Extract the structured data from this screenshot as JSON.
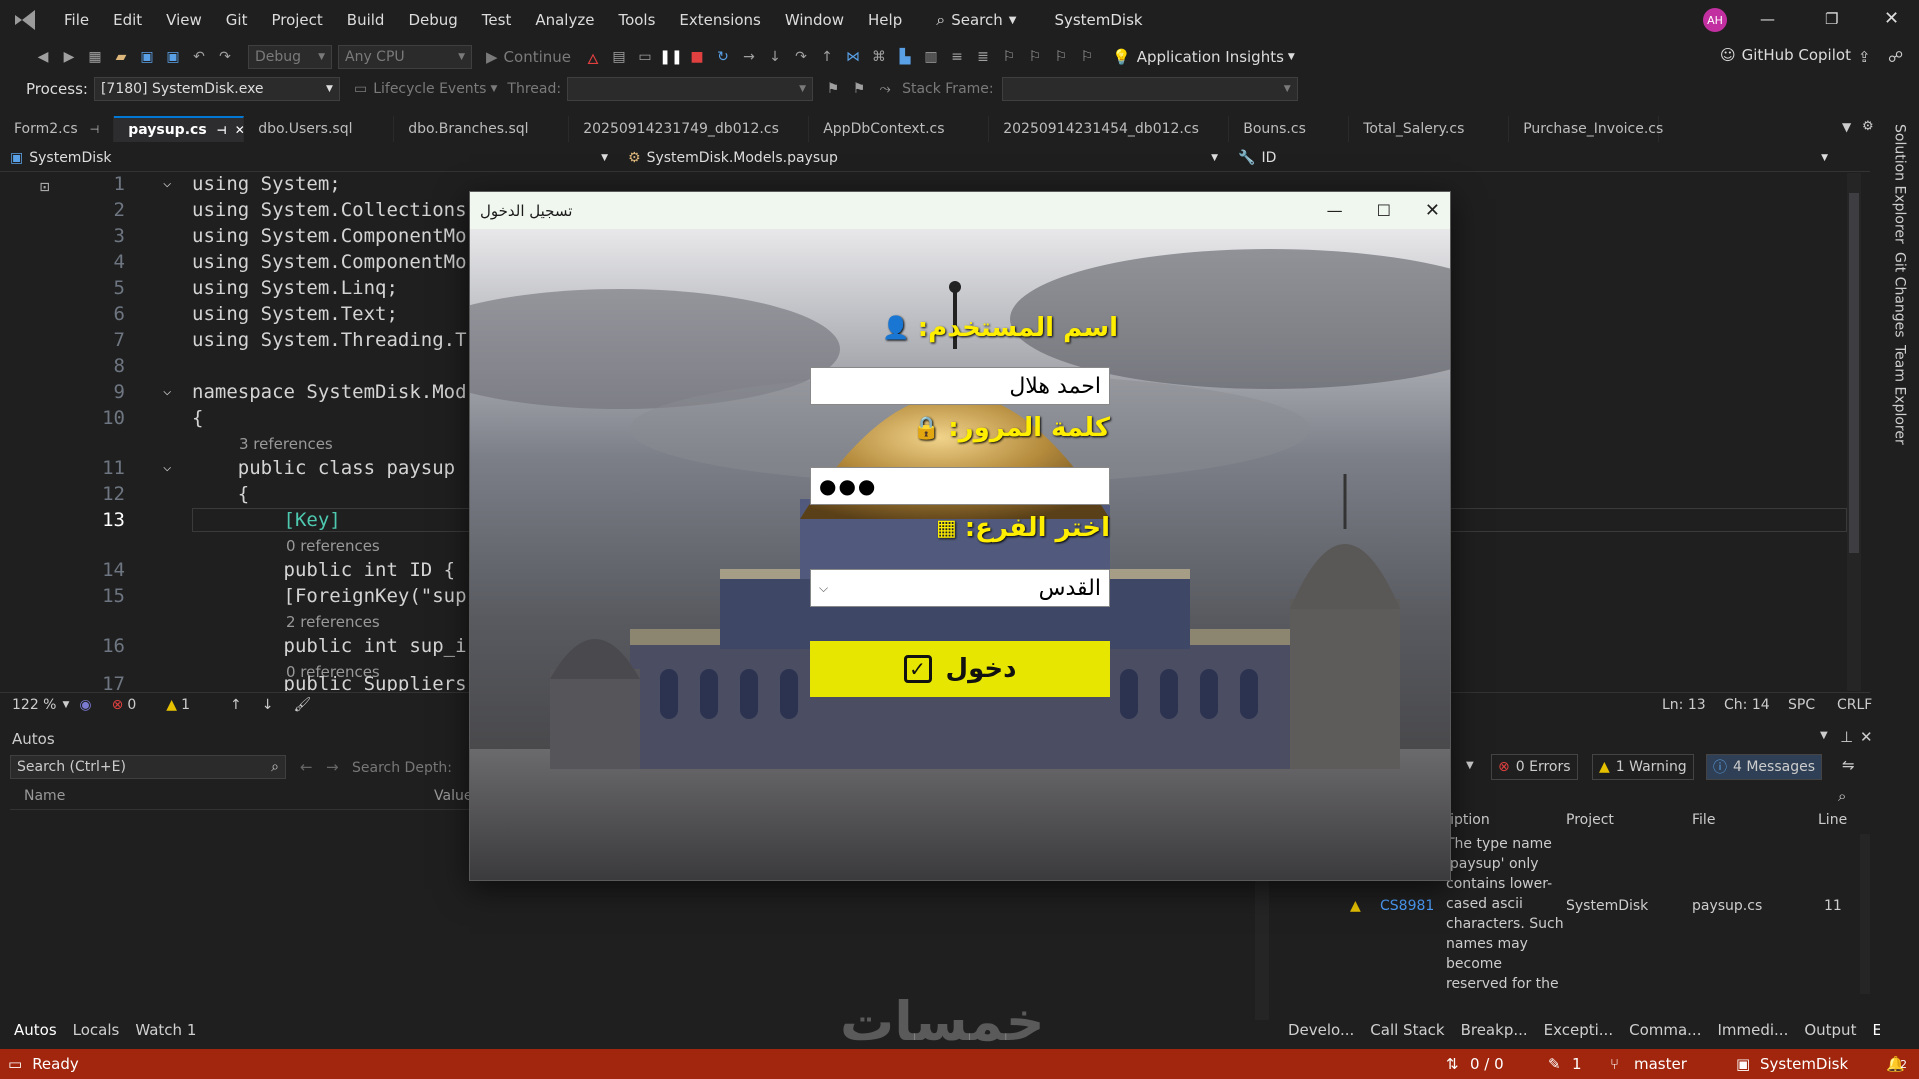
{
  "menu": {
    "items": [
      "File",
      "Edit",
      "View",
      "Git",
      "Project",
      "Build",
      "Debug",
      "Test",
      "Analyze",
      "Tools",
      "Extensions",
      "Window",
      "Help"
    ],
    "search_label": "Search",
    "solution_name": "SystemDisk",
    "avatar_initials": "AH"
  },
  "toolbar": {
    "config": "Debug",
    "platform": "Any CPU",
    "continue_label": "Continue",
    "app_insights": "Application Insights",
    "copilot": "GitHub Copilot"
  },
  "toolbar2": {
    "process_label": "Process:",
    "process_value": "[7180] SystemDisk.exe",
    "lifecycle": "Lifecycle Events",
    "thread_label": "Thread:",
    "stack_label": "Stack Frame:"
  },
  "tabs": [
    "Form2.cs",
    "paysup.cs",
    "dbo.Users.sql",
    "dbo.Branches.sql",
    "20250914231749_db012.cs",
    "AppDbContext.cs",
    "20250914231454_db012.cs",
    "Bouns.cs",
    "Total_Salery.cs",
    "Purchase_Invoice.cs"
  ],
  "navbar": {
    "project": "SystemDisk",
    "class": "SystemDisk.Models.paysup",
    "member": "ID"
  },
  "code": {
    "lines": [
      {
        "n": "1",
        "t": "using System;"
      },
      {
        "n": "2",
        "t": "using System.Collections"
      },
      {
        "n": "3",
        "t": "using System.ComponentMo"
      },
      {
        "n": "4",
        "t": "using System.ComponentMo"
      },
      {
        "n": "5",
        "t": "using System.Linq;"
      },
      {
        "n": "6",
        "t": "using System.Text;"
      },
      {
        "n": "7",
        "t": "using System.Threading.T"
      },
      {
        "n": "8",
        "t": ""
      },
      {
        "n": "9",
        "t": "namespace SystemDisk.Mod"
      },
      {
        "n": "10",
        "t": "{"
      },
      {
        "n": "11",
        "t": "    public class paysup"
      },
      {
        "n": "12",
        "t": "    {"
      },
      {
        "n": "13",
        "t": "        [Key]"
      },
      {
        "n": "14",
        "t": "        public int ID {"
      },
      {
        "n": "15",
        "t": "        [ForeignKey(\"sup"
      },
      {
        "n": "16",
        "t": "        public int sup_i"
      },
      {
        "n": "17",
        "t": "        public Suppliers"
      }
    ],
    "refs": {
      "r1": "3 references",
      "r2": "0 references",
      "r3": "2 references",
      "r4": "0 references"
    }
  },
  "editor_status": {
    "zoom": "122 %",
    "errors": "0",
    "warnings": "1",
    "ln": "Ln: 13",
    "ch": "Ch: 14",
    "spc": "SPC",
    "crlf": "CRLF"
  },
  "autos": {
    "title": "Autos",
    "search_placeholder": "Search (Ctrl+E)",
    "depth_label": "Search Depth:",
    "col_name": "Name",
    "col_value": "Value"
  },
  "errorlist": {
    "errors": "0 Errors",
    "warnings": "1 Warning",
    "messages": "4 Messages",
    "col_desc": "Description",
    "col_project": "Project",
    "col_file": "File",
    "col_line": "Line",
    "row": {
      "code": "CS8981",
      "desc": "The type name 'paysup' only contains lower-cased ascii characters. Such names may become reserved for the language.",
      "project": "SystemDisk",
      "file": "paysup.cs",
      "line": "11"
    }
  },
  "bottom_tabs_left": [
    "Autos",
    "Locals",
    "Watch 1"
  ],
  "bottom_tabs_right": [
    "Develo...",
    "Call Stack",
    "Breakp...",
    "Excepti...",
    "Comma...",
    "Immedi...",
    "Output",
    "Error List"
  ],
  "side_tabs": [
    "Solution Explorer",
    "Git Changes",
    "Team Explorer"
  ],
  "statusbar": {
    "ready": "Ready",
    "updown": "0 / 0",
    "pencil": "1",
    "branch": "master",
    "repo": "SystemDisk",
    "notifications": "2"
  },
  "watermark": "خمسات",
  "dialog": {
    "title": "تسجيل الدخول",
    "username_label": "اسم المستخدم:",
    "username_value": "احمد هلال",
    "password_label": "كلمة المرور:",
    "password_value": "●●●",
    "branch_label": "اختر الفرع:",
    "branch_value": "القدس",
    "login_button": "دخول"
  },
  "colors": {
    "accent": "#0078d4",
    "status_bar": "#a1260d",
    "dialog_label": "#ffee00",
    "login_button": "#e6e600"
  }
}
